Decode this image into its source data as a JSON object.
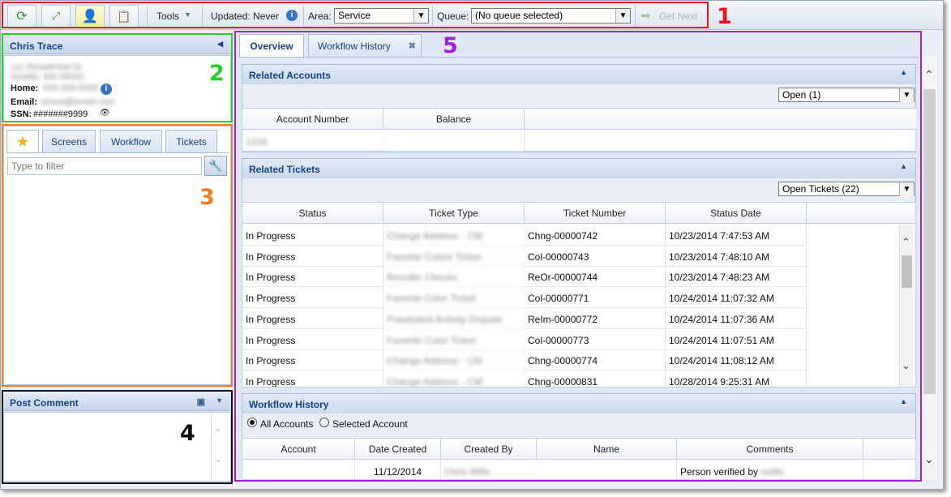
{
  "toolbar": {
    "tools_label": "Tools",
    "updated_label": "Updated: Never",
    "area_label": "Area:",
    "area_value": "Service",
    "queue_label": "Queue:",
    "queue_value": "(No queue selected)",
    "get_next_label": "Get Next"
  },
  "callouts": {
    "n1": "1",
    "n2": "2",
    "n3": "3",
    "n4": "4",
    "n5": "5"
  },
  "highlight_colors": {
    "toolbar": "#e8141c",
    "customer": "#21d321",
    "navigator": "#f3801f",
    "comment": "#111111",
    "main": "#a21ee0"
  },
  "customer": {
    "name": "Chris Trace",
    "address1": "111 Residential Dr",
    "address2": "Seattle, WA 98000",
    "home_label": "Home:",
    "home_value": "555-555-5555",
    "email_label": "Email:",
    "email_value": "ctrace@email.com",
    "ssn_label": "SSN:",
    "ssn_value": "#######9999"
  },
  "nav": {
    "tabs": [
      "Screens",
      "Workflow",
      "Tickets"
    ],
    "filter_placeholder": "Type to filter"
  },
  "post_comment": {
    "title": "Post Comment"
  },
  "main": {
    "tabs": {
      "overview": "Overview",
      "workflow_history": "Workflow History"
    }
  },
  "related_accounts": {
    "title": "Related Accounts",
    "filter": "Open (1)",
    "headers": [
      "Account Number",
      "Balance"
    ],
    "rows": [
      [
        "1234",
        ""
      ]
    ]
  },
  "related_tickets": {
    "title": "Related Tickets",
    "filter": "Open Tickets (22)",
    "headers": [
      "Status",
      "Ticket Type",
      "Ticket Number",
      "Status Date"
    ],
    "rows": [
      [
        "In Progress",
        "Change Address - CM",
        "Chng-00000742",
        "10/23/2014 7:47:53 AM"
      ],
      [
        "In Progress",
        "Favorite Colors Ticket",
        "Col-00000743",
        "10/23/2014 7:48:10 AM"
      ],
      [
        "In Progress",
        "Reorder Checks",
        "ReOr-00000744",
        "10/23/2014 7:48:23 AM"
      ],
      [
        "In Progress",
        "Favorite Color Ticket",
        "Col-00000771",
        "10/24/2014 11:07:32 AM"
      ],
      [
        "In Progress",
        "Fraudulent Activity Dispute",
        "ReIm-00000772",
        "10/24/2014 11:07:36 AM"
      ],
      [
        "In Progress",
        "Favorite Color Ticket",
        "Col-00000773",
        "10/24/2014 11:07:51 AM"
      ],
      [
        "In Progress",
        "Change Address - CM",
        "Chng-00000774",
        "10/24/2014 11:08:12 AM"
      ],
      [
        "In Progress",
        "Change Address - CM",
        "Chng-00000831",
        "10/28/2014 9:25:31 AM"
      ]
    ]
  },
  "workflow_history": {
    "title": "Workflow History",
    "radio_all": "All Accounts",
    "radio_selected": "Selected Account",
    "headers": [
      "Account",
      "Date Created",
      "Created By",
      "Name",
      "Comments"
    ],
    "rows": [
      [
        "",
        "11/12/2014",
        "Chris Wills",
        "",
        "Person verified by",
        "cwills"
      ]
    ]
  }
}
